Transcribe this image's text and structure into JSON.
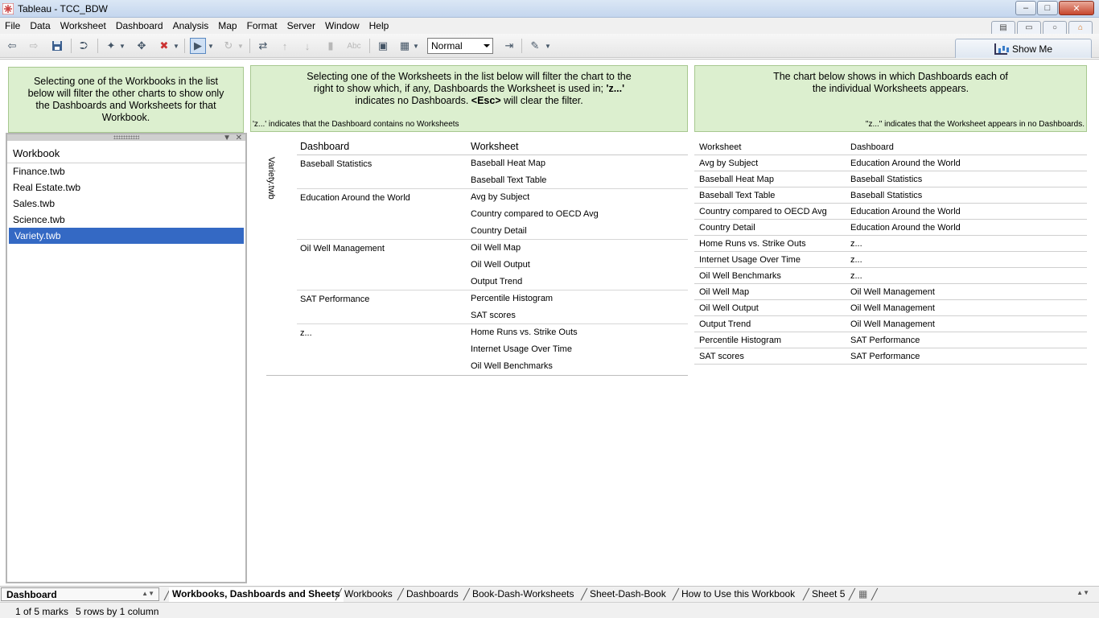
{
  "window": {
    "title": "Tableau - TCC_BDW"
  },
  "menu": [
    "File",
    "Data",
    "Worksheet",
    "Dashboard",
    "Analysis",
    "Map",
    "Format",
    "Server",
    "Window",
    "Help"
  ],
  "toolbar": {
    "fit_value": "Normal",
    "show_me_label": "Show Me",
    "abc_label": "Abc"
  },
  "textboxes": {
    "workbooks_help": "Selecting one of the Workbooks in the list below will filter the other charts to show only the Dashboards and Worksheets for that Workbook.",
    "worksheets_help_1": "Selecting one of the Worksheets in the list below will filter the chart to the right to show which, if any, Dashboards the Worksheet is used in; ",
    "worksheets_help_z": "'z...'",
    "worksheets_help_2": " indicates no Dashboards. ",
    "worksheets_help_esc": "<Esc>",
    "worksheets_help_3": " will clear the filter.",
    "worksheets_note": "'z...' indicates that the Dashboard contains no Worksheets",
    "dashboards_help": "The chart below shows in which Dashboards each of the individual Worksheets appears.",
    "dashboards_note": "\"z...\" indicates that the Worksheet appears in no Dashboards."
  },
  "workbook_filter": {
    "header": "Workbook",
    "items": [
      "Finance.twb",
      "Real Estate.twb",
      "Sales.twb",
      "Science.twb",
      "Variety.twb"
    ],
    "selected": "Variety.twb"
  },
  "dash_sheet_table": {
    "workbook_label": "Variety.twb",
    "headers": {
      "dashboard": "Dashboard",
      "worksheet": "Worksheet"
    },
    "groups": [
      {
        "dashboard": "Baseball Statistics",
        "worksheets": [
          "Baseball Heat Map",
          "Baseball Text Table"
        ]
      },
      {
        "dashboard": "Education Around the World",
        "worksheets": [
          "Avg by Subject",
          "Country compared to OECD Avg",
          "Country Detail"
        ]
      },
      {
        "dashboard": "Oil Well Management",
        "worksheets": [
          "Oil Well Map",
          "Oil Well Output",
          "Output Trend"
        ]
      },
      {
        "dashboard": "SAT Performance",
        "worksheets": [
          "Percentile Histogram",
          "SAT scores"
        ]
      },
      {
        "dashboard": "z...",
        "worksheets": [
          "Home Runs vs. Strike Outs",
          "Internet Usage Over Time",
          "Oil Well Benchmarks"
        ]
      }
    ]
  },
  "sheet_dash_table": {
    "headers": {
      "worksheet": "Worksheet",
      "dashboard": "Dashboard"
    },
    "rows": [
      [
        "Avg by Subject",
        "Education Around the World"
      ],
      [
        "Baseball Heat Map",
        "Baseball Statistics"
      ],
      [
        "Baseball Text Table",
        "Baseball Statistics"
      ],
      [
        "Country compared to OECD Avg",
        "Education Around the World"
      ],
      [
        "Country Detail",
        "Education Around the World"
      ],
      [
        "Home Runs vs. Strike Outs",
        "z..."
      ],
      [
        "Internet Usage Over Time",
        "z..."
      ],
      [
        "Oil Well Benchmarks",
        "z..."
      ],
      [
        "Oil Well Map",
        "Oil Well Management"
      ],
      [
        "Oil Well Output",
        "Oil Well Management"
      ],
      [
        "Output Trend",
        "Oil Well Management"
      ],
      [
        "Percentile Histogram",
        "SAT Performance"
      ],
      [
        "SAT scores",
        "SAT Performance"
      ]
    ]
  },
  "tabs": {
    "sheet_selector": "Dashboard",
    "items": [
      "Workbooks, Dashboards and Sheets",
      "Workbooks",
      "Dashboards",
      "Book-Dash-Worksheets",
      "Sheet-Dash-Book",
      "How to Use this Workbook",
      "Sheet 5"
    ],
    "active": "Workbooks, Dashboards and Sheets"
  },
  "status": {
    "marks": "1 of 5 marks",
    "rows": "5 rows by 1 column"
  }
}
